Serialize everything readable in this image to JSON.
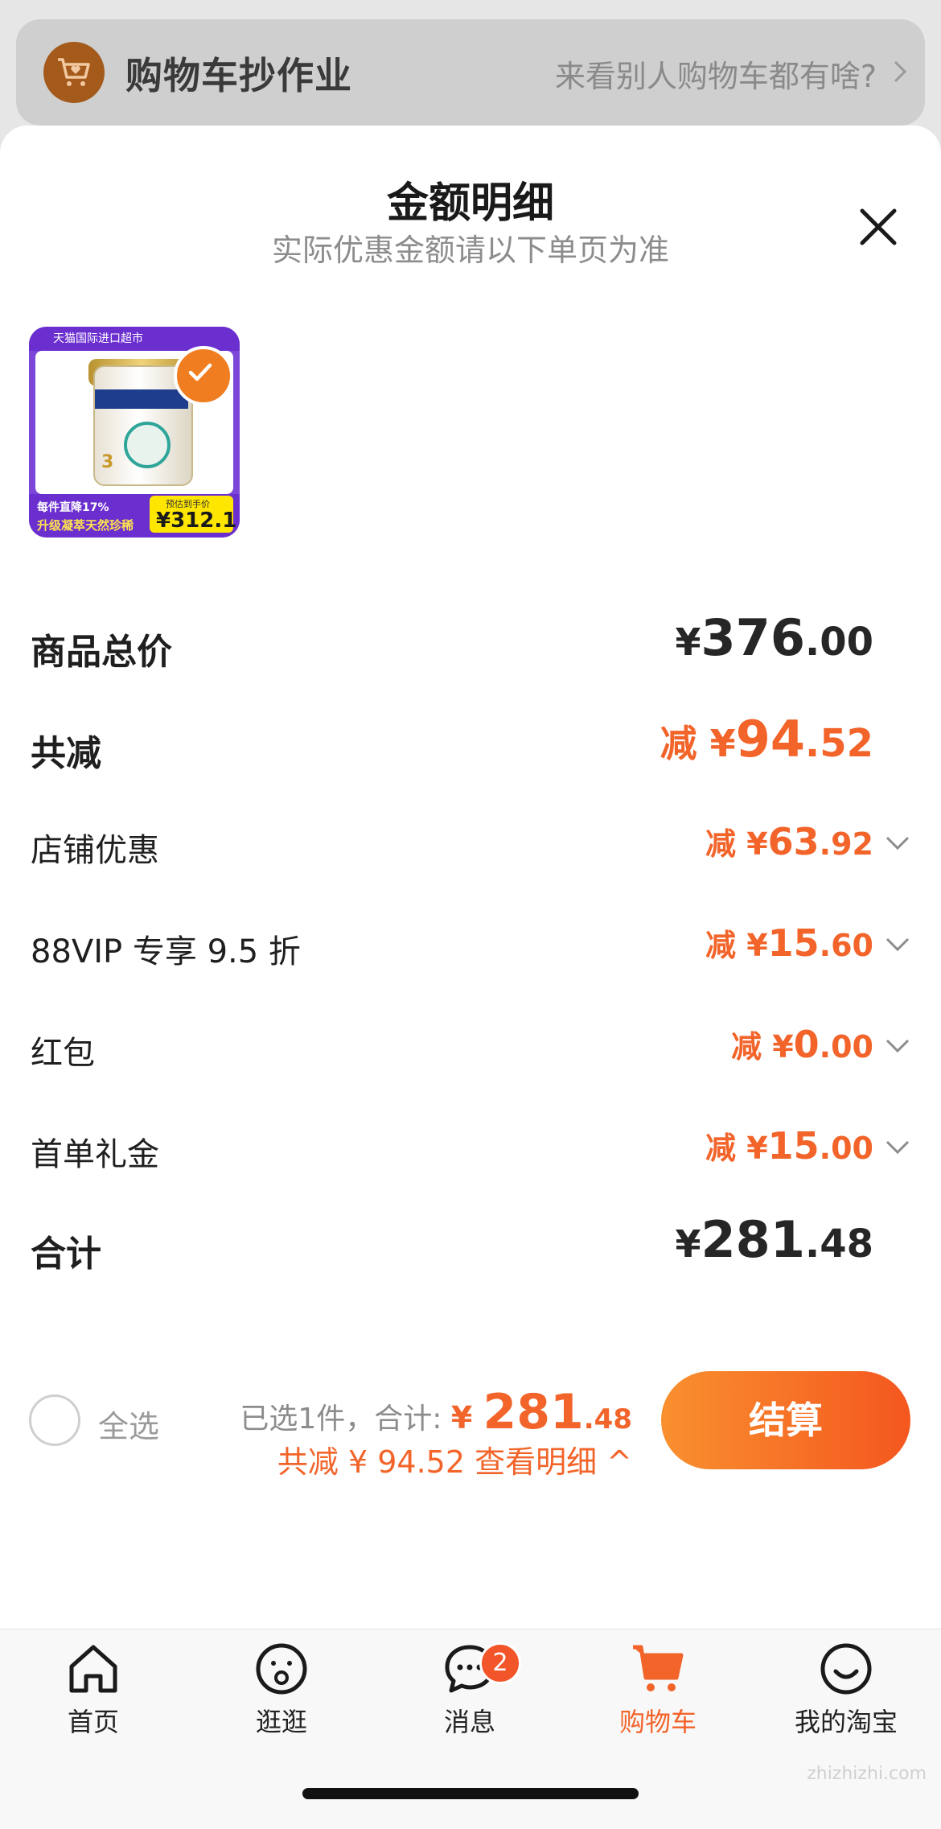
{
  "banner": {
    "title": "购物车抄作业",
    "link_text": "来看别人购物车都有啥?",
    "icon": "cart-heart-icon"
  },
  "sheet": {
    "title": "金额明细",
    "subtitle": "实际优惠金额请以下单页为准"
  },
  "product": {
    "top_text": "天猫国际进口超市",
    "can_number": "3",
    "tag1": "每件直降17%",
    "tag2": "升级凝萃天然珍稀",
    "price_label": "预估到手价",
    "price": "¥312.1",
    "selected": true
  },
  "rows": {
    "total": {
      "label": "商品总价",
      "yen": "¥",
      "int": "376",
      "dec": ".00"
    },
    "reduce": {
      "label": "共减",
      "prefix": "减 ¥",
      "int": "94",
      "dec": ".52"
    },
    "store": {
      "label": "店铺优惠",
      "prefix": "减 ¥",
      "int": "63",
      "dec": ".92"
    },
    "vip": {
      "label": "88VIP 专享 9.5 折",
      "prefix": "减 ¥",
      "int": "15",
      "dec": ".60"
    },
    "redpack": {
      "label": "红包",
      "prefix": "减 ¥",
      "int": "0",
      "dec": ".00"
    },
    "firstorder": {
      "label": "首单礼金",
      "prefix": "减 ¥",
      "int": "15",
      "dec": ".00"
    },
    "sum": {
      "label": "合计",
      "yen": "¥",
      "int": "281",
      "dec": ".48"
    }
  },
  "checkout": {
    "select_all": "全选",
    "selected_text": "已选1件，合计: ",
    "yen": "¥ ",
    "int": "281",
    "dec": ".48",
    "detail_text": "共减 ¥ 94.52 查看明细 ^",
    "button": "结算"
  },
  "tabbar": {
    "items": [
      {
        "label": "首页",
        "icon": "home-icon"
      },
      {
        "label": "逛逛",
        "icon": "browse-icon"
      },
      {
        "label": "消息",
        "icon": "message-icon",
        "badge": "2"
      },
      {
        "label": "购物车",
        "icon": "cart-icon",
        "active": true
      },
      {
        "label": "我的淘宝",
        "icon": "profile-icon"
      }
    ]
  },
  "watermark": "zhizhizhi.com",
  "colors": {
    "accent": "#f2642a",
    "banner_dim": "#cfcfcf"
  }
}
